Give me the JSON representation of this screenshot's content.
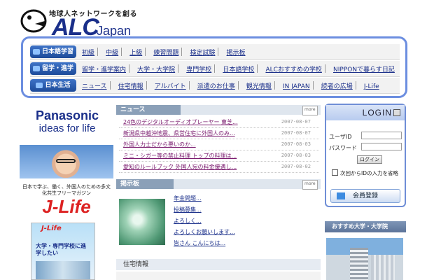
{
  "header": {
    "tagline": "地球人ネットワークを創る",
    "logo_main": "ALC",
    "logo_sub": "Japan"
  },
  "nav": {
    "rows": [
      {
        "category": "日本語学習",
        "links": [
          "初級",
          "中級",
          "上級",
          "練習問題",
          "検定試験",
          "掲示板"
        ]
      },
      {
        "category": "留学・進学",
        "links": [
          "留学・進学案内",
          "大学・大学院",
          "専門学校",
          "日本語学校",
          "ALCおすすめの学校",
          "NIPPONで暮らす日記"
        ]
      },
      {
        "category": "日本生活",
        "links": [
          "ニュース",
          "住宅情報",
          "アルバイト",
          "派遣のお仕事",
          "観光情報",
          "IN JAPAN",
          "読者の広場",
          "J-Life"
        ]
      }
    ]
  },
  "ads": {
    "panasonic_brand": "Panasonic",
    "panasonic_slogan": "ideas for life",
    "jlife_caption": "日本で学ぶ、働く、外国人のための多文化共生フリーマガジン",
    "jlife_logo": "J-Life",
    "magazine_title": "J-Life",
    "magazine_text": "大学・専門学校に進学したい"
  },
  "news": {
    "title": "ニュース",
    "more": "more",
    "items": [
      {
        "text": "24色のデジタルオーディオプレーヤー 東芝...",
        "date": "2007-08-07"
      },
      {
        "text": "新潟県中越沖地震、県営住宅に外国人のみ...",
        "date": "2007-08-07"
      },
      {
        "text": "外国人力士だから悪いのか...",
        "date": "2007-08-03"
      },
      {
        "text": "ミニ・シガー等の禁止料理 トップの料理は...",
        "date": "2007-08-03"
      },
      {
        "text": "愛知のルールブック 外国人宛の料金優遇し...",
        "date": "2007-08-02"
      }
    ]
  },
  "board": {
    "title": "掲示板",
    "more": "more",
    "items": [
      "年金問題...",
      "投稿募集...",
      "よろしく...",
      "よろしくお願いします...",
      "皆さん こんにちは..."
    ]
  },
  "housing": {
    "title": "住宅情報"
  },
  "login": {
    "title": "LOGIN",
    "user_label": "ユーザID",
    "password_label": "パスワード",
    "login_button": "ログイン",
    "remember_label": "次回からIDの入力を省略",
    "register_button": "会員登録"
  },
  "recommend": {
    "title": "おすすめ大学・大学院"
  }
}
